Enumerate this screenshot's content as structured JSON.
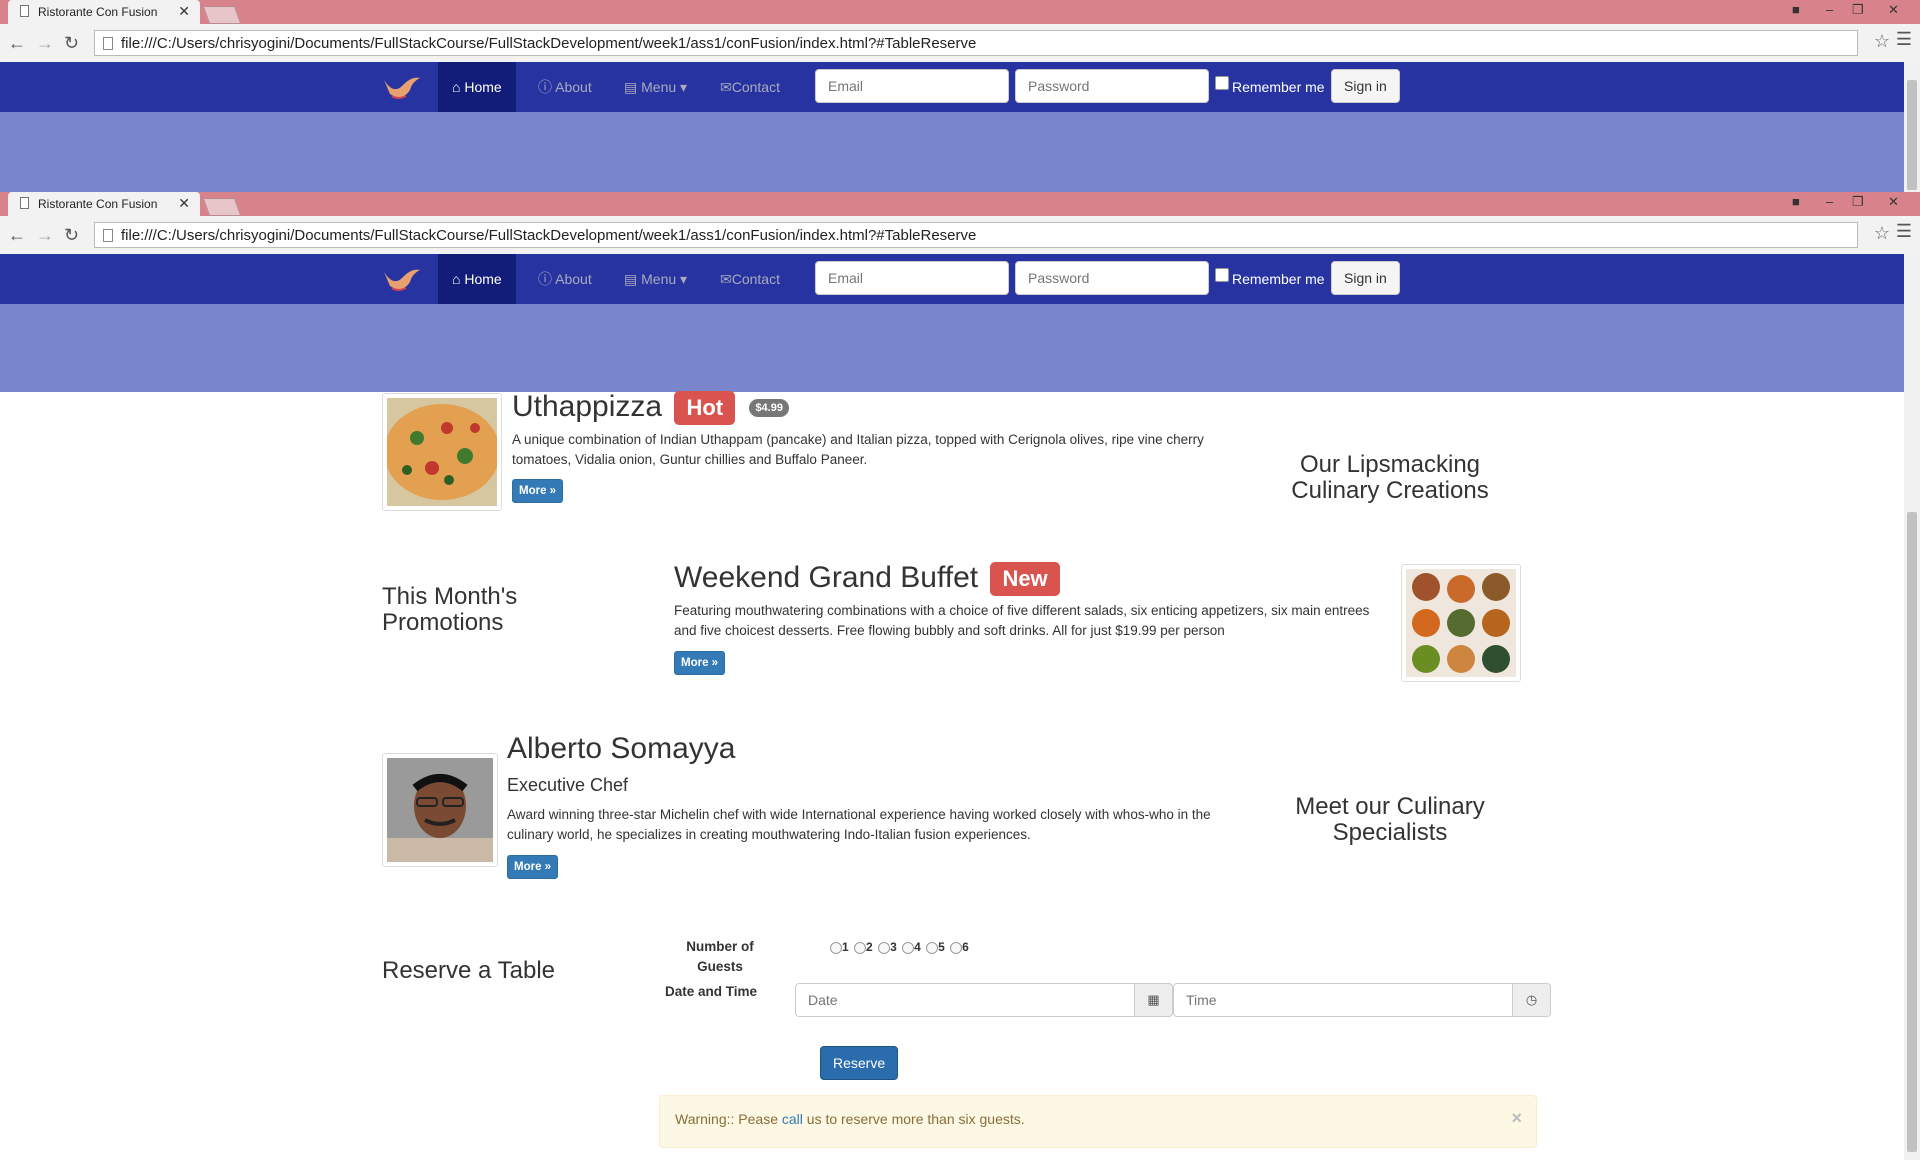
{
  "browser": {
    "tab_title": "Ristorante Con Fusion",
    "tab_close": "✕",
    "url": "file:///C:/Users/chrisyogini/Documents/FullStackCourse/FullStackDevelopment/week1/ass1/conFusion/index.html?#TableReserve"
  },
  "navbar": {
    "home": "Home",
    "about": "About",
    "menu": "Menu",
    "contact": "Contact",
    "email_placeholder": "Email",
    "password_placeholder": "Password",
    "remember": "Remember me",
    "signin": "Sign in"
  },
  "menu_section": {
    "side_title": "Our Lipsmacking Culinary Creations",
    "dish_name": "Uthappizza",
    "dish_label": "Hot",
    "dish_price": "$4.99",
    "dish_desc": "A unique combination of Indian Uthappam (pancake) and Italian pizza, topped with Cerignola olives, ripe vine cherry tomatoes, Vidalia onion, Guntur chillies and Buffalo Paneer.",
    "more": "More »"
  },
  "promo_section": {
    "side_title": "This Month's Promotions",
    "name": "Weekend Grand Buffet",
    "label": "New",
    "desc": "Featuring mouthwatering combinations with a choice of five different salads, six enticing appetizers, six main entrees and five choicest desserts. Free flowing bubbly and soft drinks. All for just $19.99 per person",
    "more": "More »"
  },
  "chef_section": {
    "side_title": "Meet our Culinary Specialists",
    "name": "Alberto Somayya",
    "role": "Executive Chef",
    "desc": "Award winning three-star Michelin chef with wide International experience having worked closely with whos-who in the culinary world, he specializes in creating mouthwatering Indo-Italian fusion experiences.",
    "more": "More »"
  },
  "reserve": {
    "title": "Reserve a Table",
    "guests_label": "Number of Guests",
    "guest_options": [
      "1",
      "2",
      "3",
      "4",
      "5",
      "6"
    ],
    "datetime_label": "Date and Time",
    "date_placeholder": "Date",
    "time_placeholder": "Time",
    "button": "Reserve",
    "alert_prefix": "Warning:: Pease ",
    "alert_link": "call",
    "alert_suffix": " us to reserve more than six guests.",
    "alert_close": "×"
  },
  "colors": {
    "navbar": "#2633a1",
    "jumbotron": "#7986cb",
    "titlebar": "#d8828c"
  }
}
